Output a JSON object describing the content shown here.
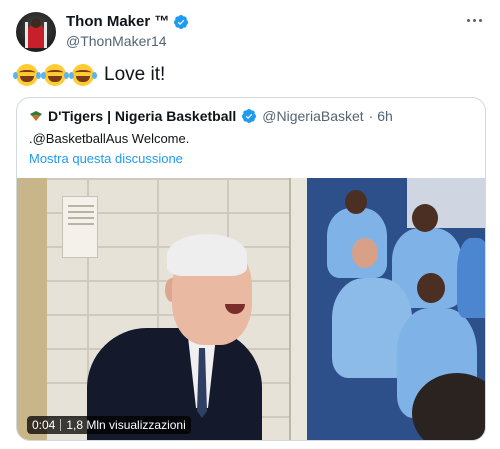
{
  "author": {
    "display_name": "Thon Maker ™",
    "handle": "@ThonMaker14"
  },
  "tweet": {
    "text": "Love it!",
    "emoji_count": 3,
    "emoji": "face-with-tears-of-joy"
  },
  "quoted_tweet": {
    "display_name": "D'Tigers | Nigeria Basketball",
    "handle": "@NigeriaBasket",
    "time": "· 6h",
    "text": ".@BasketballAus Welcome.",
    "show_thread": "Mostra questa discussione"
  },
  "video": {
    "duration": "0:04",
    "views": "1,8 Mln visualizzazioni"
  },
  "colors": {
    "accent": "#1d9bf0",
    "text_secondary": "#536471",
    "border": "#cfd9de"
  }
}
